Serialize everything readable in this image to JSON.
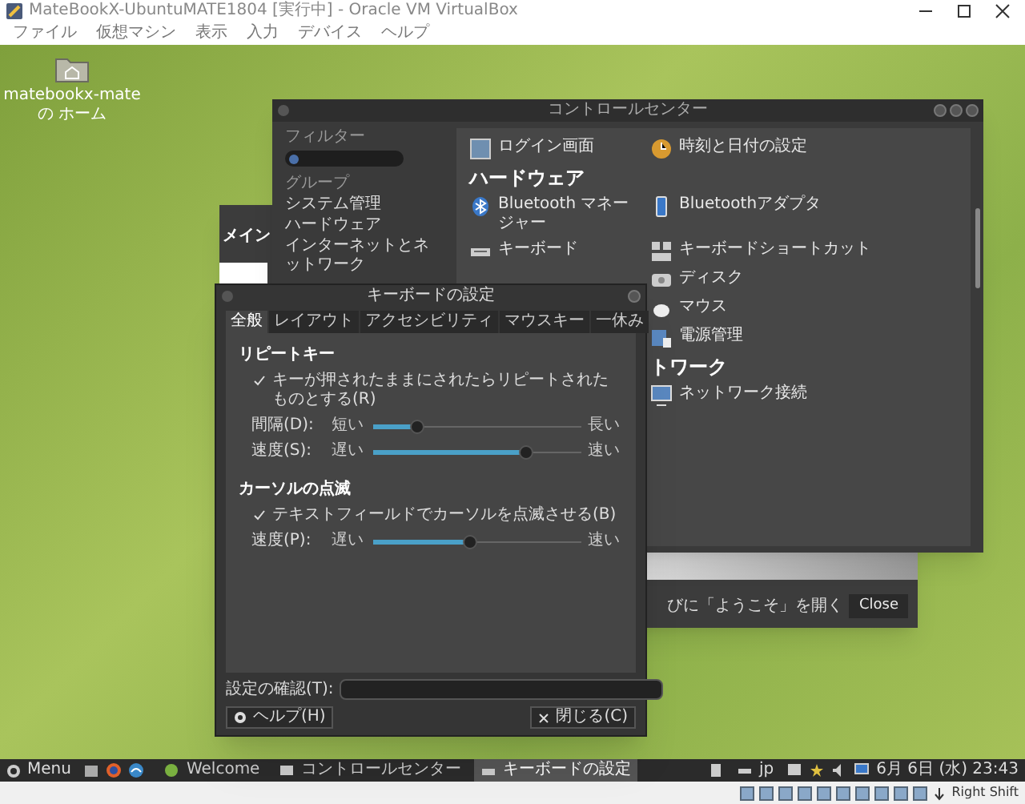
{
  "host_window": {
    "title": "MateBookX-UbuntuMATE1804 [実行中] - Oracle VM VirtualBox",
    "menu": [
      "ファイル",
      "仮想マシン",
      "表示",
      "入力",
      "デバイス",
      "ヘルプ"
    ]
  },
  "desktop_icons": [
    {
      "label": "matebookx-mateの ホーム"
    }
  ],
  "welcome_window": {
    "tab_fragment": "メイン",
    "startup_text": "びに「ようこそ」を開く",
    "close_button": "Close"
  },
  "control_center": {
    "title": "コントロールセンター",
    "filter_label": "フィルター",
    "groups_label": "グループ",
    "groups": [
      "システム管理",
      "ハードウェア",
      "インターネットとネットワーク"
    ],
    "rows": [
      {
        "kind": "items",
        "left": "ログイン画面",
        "right": "時刻と日付の設定"
      },
      {
        "kind": "heading",
        "label": "ハードウェア",
        "covered": false
      },
      {
        "kind": "items",
        "left": "Bluetooth マネージャー",
        "right": "Bluetoothアダプタ"
      },
      {
        "kind": "items",
        "left": "キーボード",
        "right": "キーボードショートカット"
      },
      {
        "kind": "items",
        "right": "ディスク"
      },
      {
        "kind": "items",
        "right": "マウス"
      },
      {
        "kind": "items",
        "right": "電源管理"
      },
      {
        "kind": "heading",
        "label": "トワーク",
        "covered": true
      },
      {
        "kind": "items",
        "right": "ネットワーク接続"
      }
    ]
  },
  "keyboard_dialog": {
    "title": "キーボードの設定",
    "tabs": [
      {
        "label": "全般",
        "selected": true
      },
      {
        "label": "レイアウト",
        "selected": false
      },
      {
        "label": "アクセシビリティ",
        "selected": false
      },
      {
        "label": "マウスキー",
        "selected": false
      },
      {
        "label": "一休み",
        "selected": false
      }
    ],
    "sections": [
      {
        "heading": "リピートキー",
        "checkbox": {
          "label": "キーが押されたままにされたらリピートされたものとする(R)",
          "checked": true
        },
        "sliders": [
          {
            "label": "間隔(D):",
            "min_label": "短い",
            "max_label": "長い",
            "level": 0.21
          },
          {
            "label": "速度(S):",
            "min_label": "遅い",
            "max_label": "速い",
            "level": 0.73
          }
        ]
      },
      {
        "heading": "カーソルの点滅",
        "checkbox": {
          "label": "テキストフィールドでカーソルを点滅させる(B)",
          "checked": true
        },
        "sliders": [
          {
            "label": "速度(P):",
            "min_label": "遅い",
            "max_label": "速い",
            "level": 0.46
          }
        ]
      }
    ],
    "test_field_label": "設定の確認(T):",
    "help_button": "ヘルプ(H)",
    "close_button": "閉じる(C)"
  },
  "taskbar": {
    "menu_label": "Menu",
    "tasks": [
      {
        "label": "Welcome",
        "selected": false
      },
      {
        "label": "コントロールセンター",
        "selected": false
      },
      {
        "label": "キーボードの設定",
        "selected": true
      }
    ],
    "keyboard_layout": "jp",
    "clock": "6月 6日 (水) 23:43"
  },
  "host_status_bar": {
    "host_key": "Right Shift"
  }
}
